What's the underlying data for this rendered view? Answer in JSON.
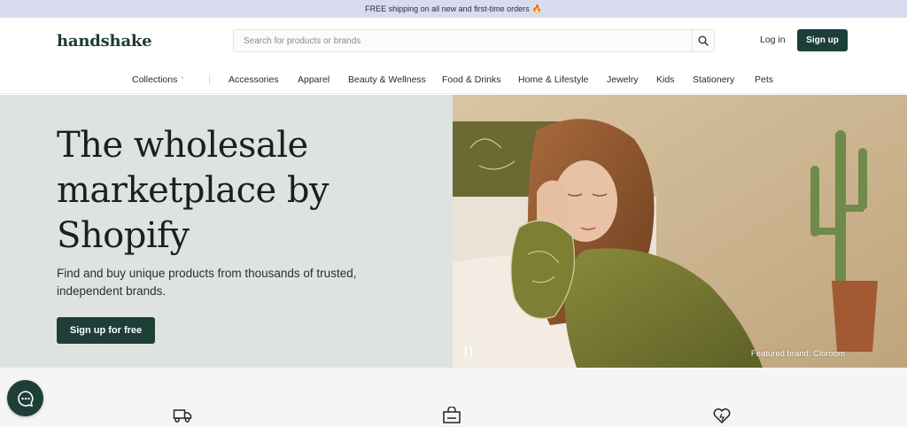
{
  "promo": {
    "text": "FREE shipping on all new and first-time orders",
    "icon": "flame-icon"
  },
  "header": {
    "logo": "handshake",
    "search_placeholder": "Search for products or brands",
    "login_label": "Log in",
    "signup_label": "Sign up"
  },
  "nav": {
    "collections": "Collections",
    "items": [
      "Accessories",
      "Apparel",
      "Beauty & Wellness",
      "Food & Drinks",
      "Home & Lifestyle",
      "Jewelry",
      "Kids",
      "Stationery",
      "Pets"
    ]
  },
  "hero": {
    "title": "The wholesale\nmarketplace by\nShopify",
    "subtitle": "Find and buy unique products from thousands of trusted, independent brands.",
    "cta_label": "Sign up for free",
    "featured": "Featured brand: Cloroom"
  },
  "features": {
    "icons": [
      "truck-icon",
      "bag-icon",
      "heart-icon"
    ]
  },
  "colors": {
    "brand": "#1e3e38",
    "promo_bg": "#d9dcef",
    "hero_bg": "#dfe3df"
  }
}
